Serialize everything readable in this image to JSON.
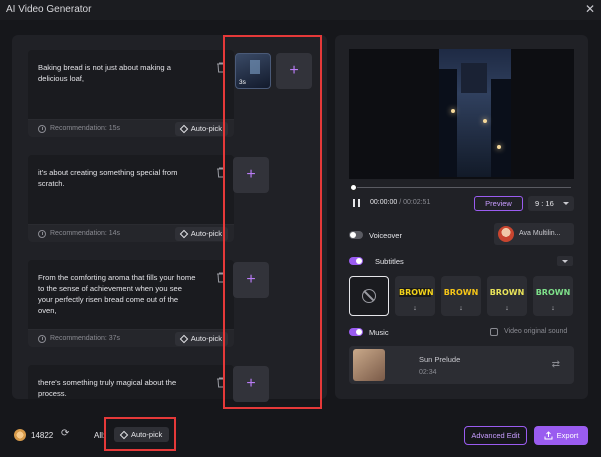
{
  "window": {
    "title": "AI Video Generator",
    "close_icon": "close-icon"
  },
  "segments": [
    {
      "text": "Baking bread is not just about making a delicious loaf,",
      "recommendation": "Recommendation: 15s",
      "autopick_label": "Auto-pick"
    },
    {
      "text": "it's about creating something special from scratch.",
      "recommendation": "Recommendation: 14s",
      "autopick_label": "Auto-pick"
    },
    {
      "text": "From the comforting aroma that fills your home to the sense of achievement when you see your perfectly risen bread come out of the oven,",
      "recommendation": "Recommendation: 37s",
      "autopick_label": "Auto-pick"
    },
    {
      "text": "there's something truly magical about the process."
    }
  ],
  "media": {
    "thumb_duration": "3s",
    "add_glyph": "+"
  },
  "player": {
    "current_time": "00:00:00",
    "separator": " / ",
    "total_time": "00:02:51",
    "preview_label": "Preview",
    "ratio": "9 : 16"
  },
  "voiceover": {
    "label": "Voiceover",
    "enabled": false,
    "voice_name": "Ava Multilin..."
  },
  "subtitles": {
    "label": "Subtitles",
    "enabled": true,
    "styles": [
      {
        "text": "BROWN",
        "color": "#f2d21b",
        "bg": "#1a1a1a"
      },
      {
        "text": "BROWN",
        "color": "#f5c518",
        "bg": "#2c2d33"
      },
      {
        "text": "BROWN",
        "color": "#e8e35a",
        "bg": "#2c2d33"
      },
      {
        "text": "BROWN",
        "color": "#7ee08a",
        "bg": "#2c2d33"
      }
    ]
  },
  "music": {
    "label": "Music",
    "enabled": true,
    "original_sound_label": "Video original sound",
    "track_title": "Sun Prelude",
    "track_duration": "02:34"
  },
  "footer": {
    "credits": "14822",
    "all_label": "All:",
    "all_autopick_label": "Auto-pick",
    "advanced_edit_label": "Advanced Edit",
    "export_label": "Export"
  },
  "colors": {
    "accent": "#9a5cf0",
    "highlight_border": "#e53939",
    "background": "#16171b"
  }
}
